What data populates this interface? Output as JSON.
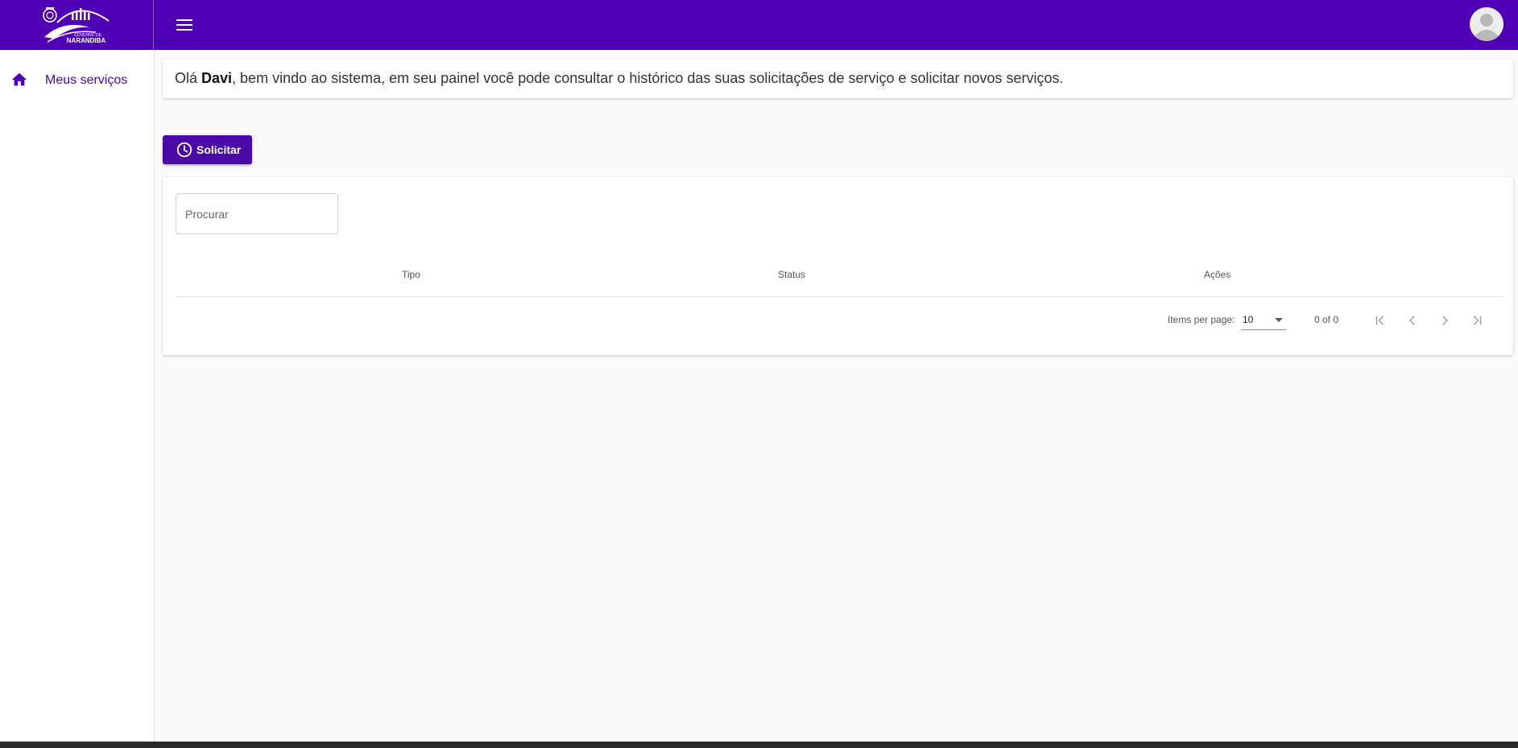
{
  "brand": {
    "logo_line1": "GOVERNO DE",
    "logo_line2": "NARANDIBA"
  },
  "topbar": {
    "menu_icon": "menu-icon",
    "avatar_icon": "account-circle-icon",
    "color": "#5000b4"
  },
  "sidebar": {
    "items": [
      {
        "label": "Meus serviços",
        "icon": "home-icon"
      }
    ]
  },
  "welcome": {
    "greeting": "Olá ",
    "user_name": "Davi",
    "message": ", bem vindo ao sistema, em seu painel você pode consultar o histórico das suas solicitações de serviço e solicitar novos serviços."
  },
  "actions": {
    "solicitar_label": "Solicitar",
    "solicitar_icon": "clock-icon"
  },
  "table": {
    "search_placeholder": "Procurar",
    "columns": [
      "Tipo",
      "Status",
      "Ações"
    ],
    "rows": []
  },
  "paginator": {
    "items_per_page_label": "Items per page:",
    "page_size": "10",
    "range_label": "0 of 0"
  }
}
